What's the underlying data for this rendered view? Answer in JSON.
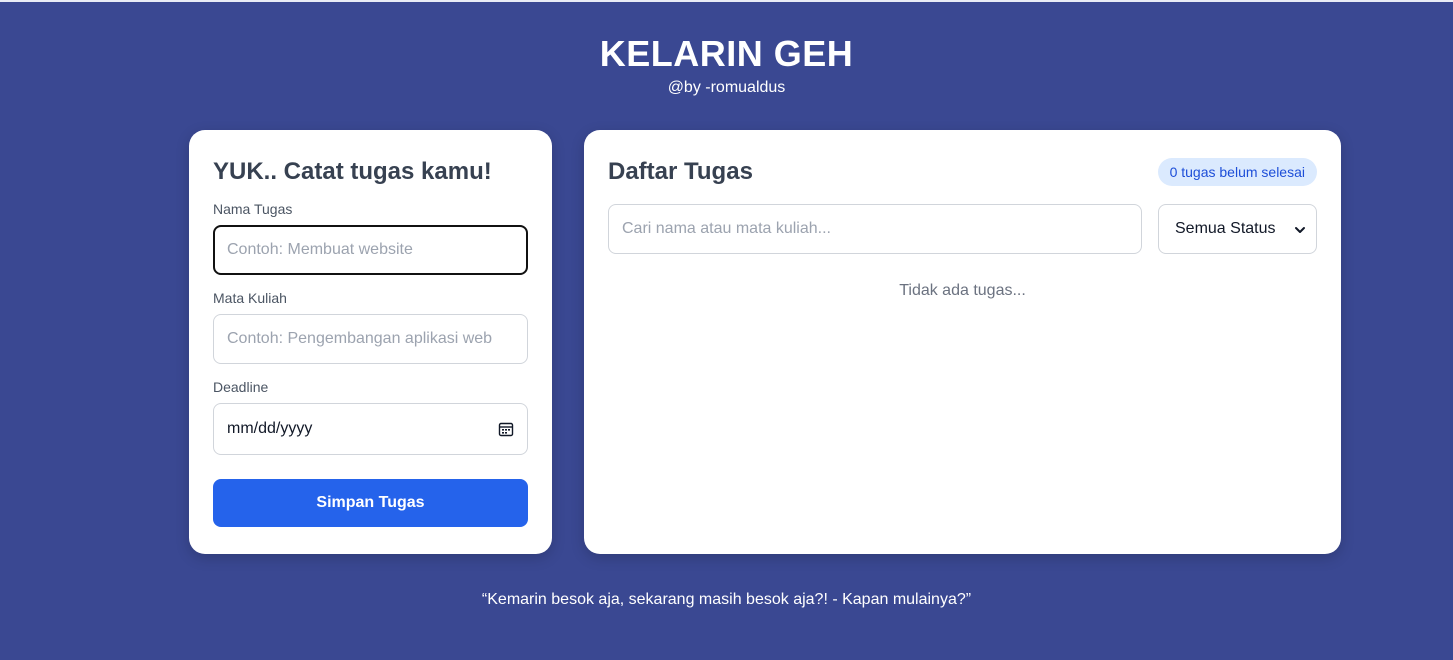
{
  "header": {
    "title": "KELARIN GEH",
    "byline": "@by -romualdus"
  },
  "form": {
    "title": "YUK.. Catat tugas kamu!",
    "task_name": {
      "label": "Nama Tugas",
      "placeholder": "Contoh: Membuat website",
      "value": ""
    },
    "course": {
      "label": "Mata Kuliah",
      "placeholder": "Contoh: Pengembangan aplikasi web",
      "value": ""
    },
    "deadline": {
      "label": "Deadline",
      "value": "mm/dd/yyyy",
      "icon": "calendar-icon"
    },
    "save_label": "Simpan Tugas",
    "save_color": "#2563eb"
  },
  "list": {
    "title": "Daftar Tugas",
    "pending_badge": "0 tugas belum selesai",
    "search": {
      "placeholder": "Cari nama atau mata kuliah...",
      "value": ""
    },
    "status_filter": {
      "selected": "Semua Status",
      "icon": "chevron-down-icon"
    },
    "empty_message": "Tidak ada tugas..."
  },
  "footer": {
    "quote": "“Kemarin besok aja, sekarang masih besok aja?! - Kapan mulainya?”"
  },
  "colors": {
    "background": "#3a4892",
    "accent": "#2563eb",
    "badge_bg": "#dbeafe"
  }
}
